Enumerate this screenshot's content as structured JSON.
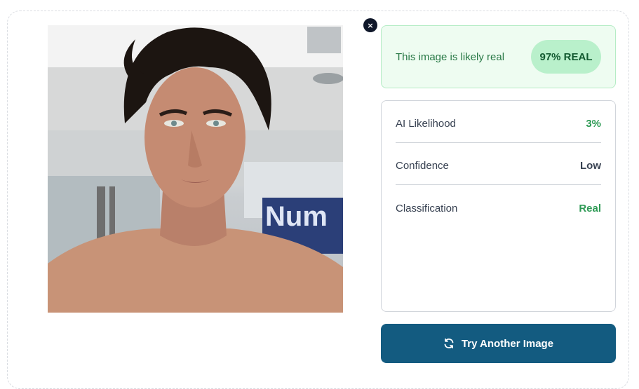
{
  "close_button": {
    "label": "×"
  },
  "verdict": {
    "message": "This image is likely real",
    "badge": "97% REAL",
    "score_percent": 97
  },
  "details": [
    {
      "label": "AI Likelihood",
      "value": "3%"
    },
    {
      "label": "Confidence",
      "value": "Low"
    },
    {
      "label": "Classification",
      "value": "Real"
    }
  ],
  "photo": {
    "sign_text": "Num"
  },
  "actions": {
    "try_another_label": "Try Another Image",
    "icon": "refresh-icon"
  },
  "colors": {
    "accent": "#135b80",
    "success": "#2e9a55",
    "success_bg": "#eefcf1",
    "badge_bg": "#b9f0cb"
  }
}
